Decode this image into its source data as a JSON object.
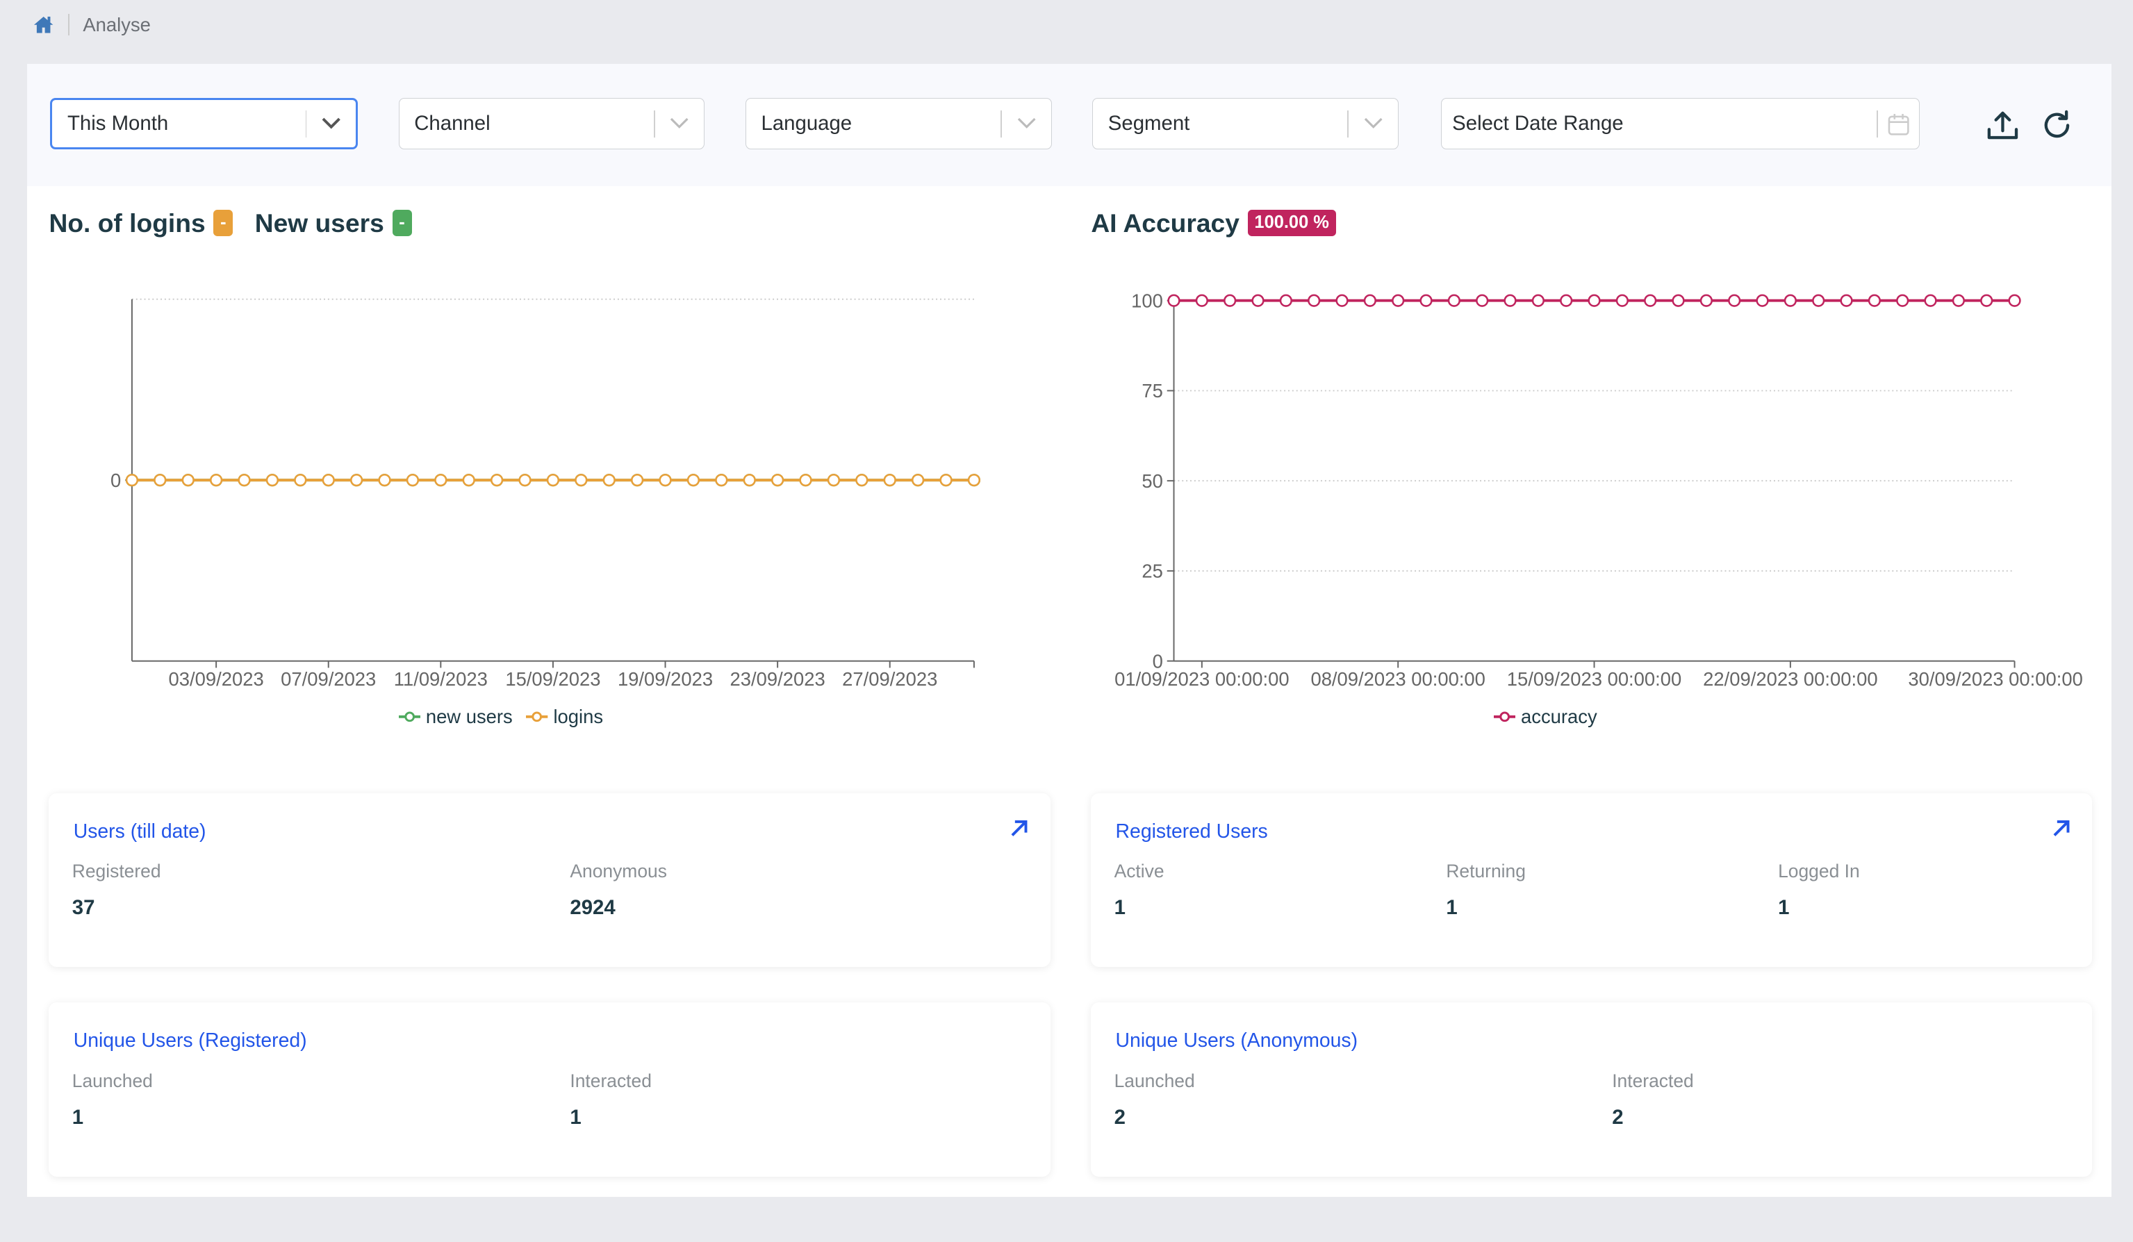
{
  "breadcrumb": {
    "home_icon": "home-icon",
    "current": "Analyse"
  },
  "filters": {
    "period": "This Month",
    "channel": "Channel",
    "language": "Language",
    "segment": "Segment",
    "date_range_placeholder": "Select Date Range",
    "export_icon": "upload-icon",
    "refresh_icon": "refresh-icon"
  },
  "logins_panel": {
    "logins_title": "No. of logins",
    "logins_badge": "-",
    "new_users_title": "New users",
    "new_users_badge": "-"
  },
  "accuracy_panel": {
    "title": "AI Accuracy",
    "badge": "100.00 %"
  },
  "colors": {
    "logins": "#e8a03a",
    "new_users": "#4faa5e",
    "accuracy": "#c0245e",
    "link": "#2255e8"
  },
  "chart_data": [
    {
      "type": "line",
      "x": [
        "31/08/2023",
        "01/09/2023",
        "02/09/2023",
        "03/09/2023",
        "04/09/2023",
        "05/09/2023",
        "06/09/2023",
        "07/09/2023",
        "08/09/2023",
        "09/09/2023",
        "10/09/2023",
        "11/09/2023",
        "12/09/2023",
        "13/09/2023",
        "14/09/2023",
        "15/09/2023",
        "16/09/2023",
        "17/09/2023",
        "18/09/2023",
        "19/09/2023",
        "20/09/2023",
        "21/09/2023",
        "22/09/2023",
        "23/09/2023",
        "24/09/2023",
        "25/09/2023",
        "26/09/2023",
        "27/09/2023",
        "28/09/2023",
        "29/09/2023",
        "30/09/2023"
      ],
      "xticks": [
        "03/09/2023",
        "07/09/2023",
        "11/09/2023",
        "15/09/2023",
        "19/09/2023",
        "23/09/2023",
        "27/09/2023"
      ],
      "yticks": [
        "0"
      ],
      "ylim": [
        -1,
        1
      ],
      "grid": true,
      "legend": "bottom",
      "series": [
        {
          "name": "new users",
          "color": "#4faa5e",
          "values": [
            0,
            0,
            0,
            0,
            0,
            0,
            0,
            0,
            0,
            0,
            0,
            0,
            0,
            0,
            0,
            0,
            0,
            0,
            0,
            0,
            0,
            0,
            0,
            0,
            0,
            0,
            0,
            0,
            0,
            0,
            0
          ]
        },
        {
          "name": "logins",
          "color": "#e8a03a",
          "values": [
            0,
            0,
            0,
            0,
            0,
            0,
            0,
            0,
            0,
            0,
            0,
            0,
            0,
            0,
            0,
            0,
            0,
            0,
            0,
            0,
            0,
            0,
            0,
            0,
            0,
            0,
            0,
            0,
            0,
            0,
            0
          ]
        }
      ]
    },
    {
      "type": "line",
      "x": [
        "31/08/2023",
        "01/09/2023",
        "02/09/2023",
        "03/09/2023",
        "04/09/2023",
        "05/09/2023",
        "06/09/2023",
        "07/09/2023",
        "08/09/2023",
        "09/09/2023",
        "10/09/2023",
        "11/09/2023",
        "12/09/2023",
        "13/09/2023",
        "14/09/2023",
        "15/09/2023",
        "16/09/2023",
        "17/09/2023",
        "18/09/2023",
        "19/09/2023",
        "20/09/2023",
        "21/09/2023",
        "22/09/2023",
        "23/09/2023",
        "24/09/2023",
        "25/09/2023",
        "26/09/2023",
        "27/09/2023",
        "28/09/2023",
        "29/09/2023",
        "30/09/2023"
      ],
      "xticks": [
        "01/09/2023 00:00:00",
        "08/09/2023 00:00:00",
        "15/09/2023 00:00:00",
        "22/09/2023 00:00:00",
        "30/09/2023 00:00:00"
      ],
      "yticks": [
        "0",
        "25",
        "50",
        "75",
        "100"
      ],
      "ylim": [
        0,
        100
      ],
      "grid": true,
      "legend": "bottom",
      "series": [
        {
          "name": "accuracy",
          "color": "#c0245e",
          "values": [
            100,
            100,
            100,
            100,
            100,
            100,
            100,
            100,
            100,
            100,
            100,
            100,
            100,
            100,
            100,
            100,
            100,
            100,
            100,
            100,
            100,
            100,
            100,
            100,
            100,
            100,
            100,
            100,
            100,
            100,
            100
          ]
        }
      ]
    }
  ],
  "cards": [
    {
      "title": "Users (till date)",
      "link_icon": "arrow-up-right-icon",
      "stats": [
        {
          "label": "Registered",
          "value": "37"
        },
        {
          "label": "Anonymous",
          "value": "2924"
        }
      ]
    },
    {
      "title": "Registered Users",
      "link_icon": "arrow-up-right-icon",
      "stats": [
        {
          "label": "Active",
          "value": "1"
        },
        {
          "label": "Returning",
          "value": "1"
        },
        {
          "label": "Logged In",
          "value": "1"
        }
      ]
    },
    {
      "title": "Unique Users (Registered)",
      "stats": [
        {
          "label": "Launched",
          "value": "1"
        },
        {
          "label": "Interacted",
          "value": "1"
        }
      ]
    },
    {
      "title": "Unique Users (Anonymous)",
      "stats": [
        {
          "label": "Launched",
          "value": "2"
        },
        {
          "label": "Interacted",
          "value": "2"
        }
      ]
    }
  ]
}
